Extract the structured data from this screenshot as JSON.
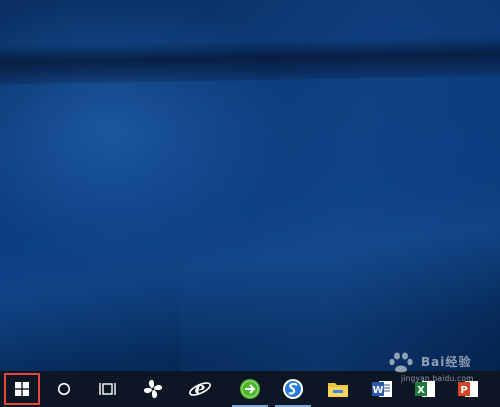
{
  "taskbar": {
    "items": [
      {
        "name": "Start"
      },
      {
        "name": "Cortana search"
      },
      {
        "name": "Task View"
      },
      {
        "name": "Pinned app"
      },
      {
        "name": "Internet Explorer"
      },
      {
        "name": "360 Secure Browser"
      },
      {
        "name": "Sogou Browser"
      },
      {
        "name": "File Explorer"
      },
      {
        "name": "Microsoft Word"
      },
      {
        "name": "Microsoft Excel"
      },
      {
        "name": "Microsoft PowerPoint"
      }
    ]
  },
  "watermark": {
    "title": "Bai经验",
    "url": "jingyan.baidu.com"
  },
  "colors": {
    "taskbar": "#0d1624",
    "start_highlight": "#e8453c",
    "desktop": "#0b3a79"
  }
}
